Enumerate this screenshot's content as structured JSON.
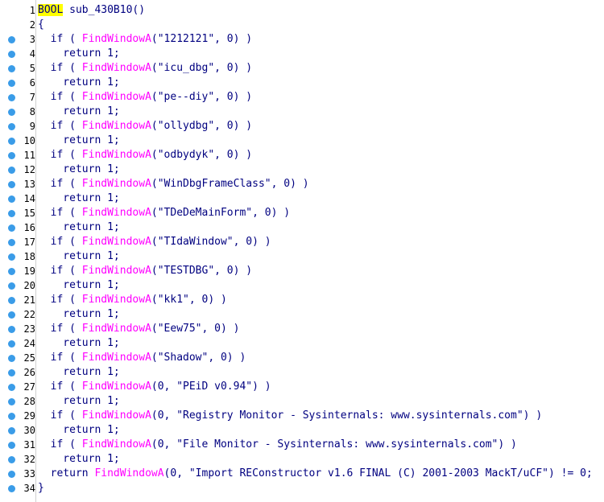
{
  "colors": {
    "breakpoint_dot": "#3a9ce8",
    "text": "#000080",
    "function_call": "#ff00ff",
    "string_literal": "#008000",
    "highlight": "#ffff00"
  },
  "icons": {
    "line_marker": "breakpoint-dot-icon"
  },
  "lines": [
    {
      "n": "1",
      "dot": false,
      "parts": [
        [
          "type",
          "BOOL"
        ],
        [
          "t",
          " sub_430B10()"
        ]
      ]
    },
    {
      "n": "2",
      "dot": false,
      "parts": [
        [
          "t",
          "{"
        ]
      ]
    },
    {
      "n": "3",
      "dot": true,
      "parts": [
        [
          "t",
          "  if ( "
        ],
        [
          "f",
          "FindWindowA"
        ],
        [
          "t",
          "(\"1212121\", 0) )"
        ]
      ]
    },
    {
      "n": "4",
      "dot": true,
      "parts": [
        [
          "t",
          "    return 1;"
        ]
      ]
    },
    {
      "n": "5",
      "dot": true,
      "parts": [
        [
          "t",
          "  if ( "
        ],
        [
          "f",
          "FindWindowA"
        ],
        [
          "t",
          "(\"icu_dbg\", 0) )"
        ]
      ]
    },
    {
      "n": "6",
      "dot": true,
      "parts": [
        [
          "t",
          "    return 1;"
        ]
      ]
    },
    {
      "n": "7",
      "dot": true,
      "parts": [
        [
          "t",
          "  if ( "
        ],
        [
          "f",
          "FindWindowA"
        ],
        [
          "t",
          "(\"pe--diy\", 0) )"
        ]
      ]
    },
    {
      "n": "8",
      "dot": true,
      "parts": [
        [
          "t",
          "    return 1;"
        ]
      ]
    },
    {
      "n": "9",
      "dot": true,
      "parts": [
        [
          "t",
          "  if ( "
        ],
        [
          "f",
          "FindWindowA"
        ],
        [
          "t",
          "(\"ollydbg\", 0) )"
        ]
      ]
    },
    {
      "n": "10",
      "dot": true,
      "parts": [
        [
          "t",
          "    return 1;"
        ]
      ]
    },
    {
      "n": "11",
      "dot": true,
      "parts": [
        [
          "t",
          "  if ( "
        ],
        [
          "f",
          "FindWindowA"
        ],
        [
          "t",
          "(\"odbydyk\", 0) )"
        ]
      ]
    },
    {
      "n": "12",
      "dot": true,
      "parts": [
        [
          "t",
          "    return 1;"
        ]
      ]
    },
    {
      "n": "13",
      "dot": true,
      "parts": [
        [
          "t",
          "  if ( "
        ],
        [
          "f",
          "FindWindowA"
        ],
        [
          "t",
          "(\"WinDbgFrameClass\", 0) )"
        ]
      ]
    },
    {
      "n": "14",
      "dot": true,
      "parts": [
        [
          "t",
          "    return 1;"
        ]
      ]
    },
    {
      "n": "15",
      "dot": true,
      "parts": [
        [
          "t",
          "  if ( "
        ],
        [
          "f",
          "FindWindowA"
        ],
        [
          "t",
          "(\"TDeDeMainForm\", 0) )"
        ]
      ]
    },
    {
      "n": "16",
      "dot": true,
      "parts": [
        [
          "t",
          "    return 1;"
        ]
      ]
    },
    {
      "n": "17",
      "dot": true,
      "parts": [
        [
          "t",
          "  if ( "
        ],
        [
          "f",
          "FindWindowA"
        ],
        [
          "t",
          "(\"TIdaWindow\", 0) )"
        ]
      ]
    },
    {
      "n": "18",
      "dot": true,
      "parts": [
        [
          "t",
          "    return 1;"
        ]
      ]
    },
    {
      "n": "19",
      "dot": true,
      "parts": [
        [
          "t",
          "  if ( "
        ],
        [
          "f",
          "FindWindowA"
        ],
        [
          "t",
          "(\"TESTDBG\", 0) )"
        ]
      ]
    },
    {
      "n": "20",
      "dot": true,
      "parts": [
        [
          "t",
          "    return 1;"
        ]
      ]
    },
    {
      "n": "21",
      "dot": true,
      "parts": [
        [
          "t",
          "  if ( "
        ],
        [
          "f",
          "FindWindowA"
        ],
        [
          "t",
          "(\"kk1\", 0) )"
        ]
      ]
    },
    {
      "n": "22",
      "dot": true,
      "parts": [
        [
          "t",
          "    return 1;"
        ]
      ]
    },
    {
      "n": "23",
      "dot": true,
      "parts": [
        [
          "t",
          "  if ( "
        ],
        [
          "f",
          "FindWindowA"
        ],
        [
          "t",
          "(\"Eew75\", 0) )"
        ]
      ]
    },
    {
      "n": "24",
      "dot": true,
      "parts": [
        [
          "t",
          "    return 1;"
        ]
      ]
    },
    {
      "n": "25",
      "dot": true,
      "parts": [
        [
          "t",
          "  if ( "
        ],
        [
          "f",
          "FindWindowA"
        ],
        [
          "t",
          "(\"Shadow\", 0) )"
        ]
      ]
    },
    {
      "n": "26",
      "dot": true,
      "parts": [
        [
          "t",
          "    return 1;"
        ]
      ]
    },
    {
      "n": "27",
      "dot": true,
      "parts": [
        [
          "t",
          "  if ( "
        ],
        [
          "f",
          "FindWindowA"
        ],
        [
          "t",
          "(0, \"PEiD v0.94\") )"
        ]
      ]
    },
    {
      "n": "28",
      "dot": true,
      "parts": [
        [
          "t",
          "    return 1;"
        ]
      ]
    },
    {
      "n": "29",
      "dot": true,
      "parts": [
        [
          "t",
          "  if ( "
        ],
        [
          "f",
          "FindWindowA"
        ],
        [
          "t",
          "(0, \"Registry Monitor - Sysinternals: www.sysinternals.com\") )"
        ]
      ]
    },
    {
      "n": "30",
      "dot": true,
      "parts": [
        [
          "t",
          "    return 1;"
        ]
      ]
    },
    {
      "n": "31",
      "dot": true,
      "parts": [
        [
          "t",
          "  if ( "
        ],
        [
          "f",
          "FindWindowA"
        ],
        [
          "t",
          "(0, \"File Monitor - Sysinternals: www.sysinternals.com\") )"
        ]
      ]
    },
    {
      "n": "32",
      "dot": true,
      "parts": [
        [
          "t",
          "    return 1;"
        ]
      ]
    },
    {
      "n": "33",
      "dot": true,
      "parts": [
        [
          "t",
          "  return "
        ],
        [
          "f",
          "FindWindowA"
        ],
        [
          "t",
          "(0, \"Import REConstructor v1.6 FINAL (C) 2001-2003 MackT/uCF\") != 0;"
        ]
      ]
    },
    {
      "n": "34",
      "dot": true,
      "parts": [
        [
          "t",
          "}"
        ]
      ]
    }
  ]
}
